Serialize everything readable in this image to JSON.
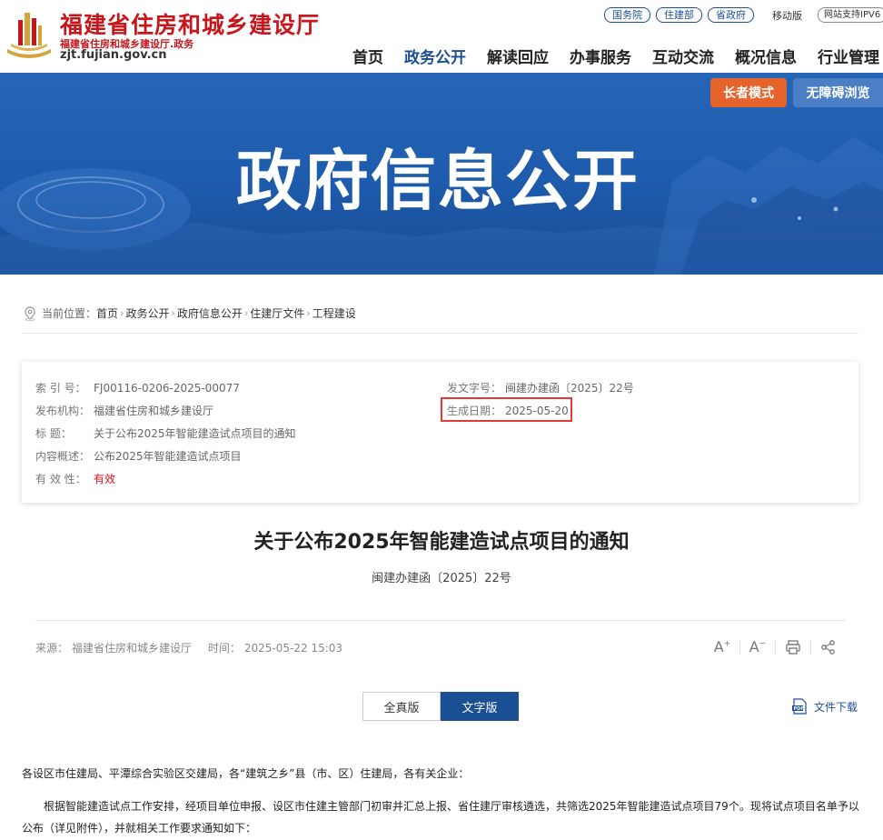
{
  "header": {
    "site_title": "福建省住房和城乡建设厅",
    "site_subtitle": "福建省住房和城乡建设厅.政务",
    "domain": "zjt.fujian.gov.cn",
    "top_links": [
      "国务院",
      "住建部",
      "省政府"
    ],
    "mobile_label": "移动版",
    "ipv6_label": "网站支持IPV6",
    "nav": [
      "首页",
      "政务公开",
      "解读回应",
      "办事服务",
      "互动交流",
      "概况信息",
      "行业管理"
    ],
    "active_nav": "政务公开"
  },
  "banner": {
    "title": "政府信息公开",
    "elder_mode": "长者模式",
    "accessible": "无障碍浏览"
  },
  "breadcrumb": {
    "prefix": "当前位置：",
    "items": [
      "首页",
      "政务公开",
      "政府信息公开",
      "住建厅文件",
      "工程建设"
    ]
  },
  "meta": {
    "index_label": "索 引 号：",
    "index_value": "FJ00116-0206-2025-00077",
    "doc_no_label": "发文字号：",
    "doc_no_value": "闽建办建函〔2025〕22号",
    "org_label": "发布机构：",
    "org_value": "福建省住房和城乡建设厅",
    "date_label": "生成日期：",
    "date_value": "2025-05-20",
    "title_label": "标      题：",
    "title_value": "关于公布2025年智能建造试点项目的通知",
    "summary_label": "内容概述：",
    "summary_value": "公布2025年智能建造试点项目",
    "validity_label": "有 效 性：",
    "validity_value": "有效"
  },
  "article": {
    "title": "关于公布2025年智能建造试点项目的通知",
    "doc_no": "闽建办建函〔2025〕22号",
    "source_label": "来源：",
    "source_value": "福建省住房和城乡建设厅",
    "time_label": "时间：",
    "time_value": "2025-05-22 15:03",
    "tabs": [
      "全真版",
      "文字版"
    ],
    "active_tab": "文字版",
    "download_label": "文件下载",
    "p1": "各设区市住建局、平潭综合实验区交建局，各“建筑之乡”县（市、区）住建局，各有关企业：",
    "p2a": "根据智能建造试点工作安排，经项目单位申报、设区市住建主管部门初审并汇总上报、省住建厅审核遴选，共筛选2025年智能建造试点项目79个。现将试点项目名单予以",
    "p2b": "公布（详见附件），并就相关工作要求通知如下："
  },
  "colors": {
    "brand_red": "#c8161d",
    "brand_blue": "#1b4f93",
    "elder_orange": "#e7632c",
    "highlight_red": "#e53935"
  }
}
